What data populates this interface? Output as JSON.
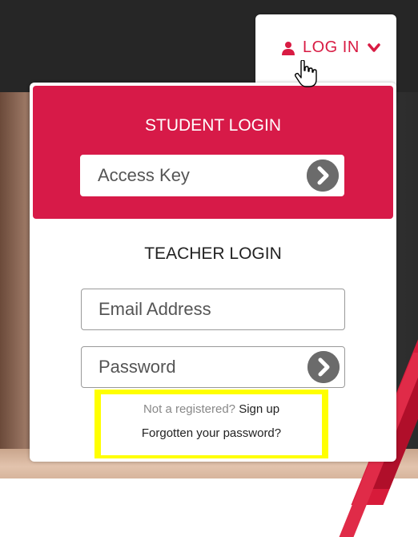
{
  "header": {
    "login_label": "LOG IN",
    "accent_color": "#d81b43"
  },
  "student": {
    "title": "STUDENT LOGIN",
    "access_key_placeholder": "Access Key",
    "box_color": "#d71a48"
  },
  "teacher": {
    "title": "TEACHER LOGIN",
    "email_placeholder": "Email Address",
    "password_placeholder": "Password"
  },
  "links": {
    "not_registered": "Not a registered?",
    "sign_up": "Sign up",
    "forgot_password": "Forgotten your password?"
  },
  "icons": [
    "user-icon",
    "chevron-down-icon",
    "hand-pointer-cursor",
    "arrow-right-circle-icon"
  ],
  "highlight_color": "#ffff00"
}
